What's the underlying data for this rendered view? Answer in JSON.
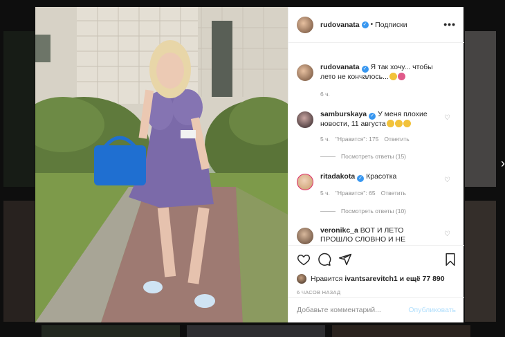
{
  "post": {
    "author": "rudovanata",
    "follow_label": "Подписки",
    "caption_user": "rudovanata",
    "caption_text": "Я так хочу... чтобы лето не кончалось...",
    "caption_time": "6 ч."
  },
  "comments": [
    {
      "user": "samburskaya",
      "text": "У меня плохие новости, 11 августа",
      "time": "5 ч.",
      "likes": "\"Нравится\": 175",
      "reply_label": "Ответить",
      "replies": "Посмотреть ответы (15)"
    },
    {
      "user": "ritadakota",
      "text": "Красотка",
      "time": "5 ч.",
      "likes": "\"Нравится\": 65",
      "reply_label": "Ответить",
      "replies": "Посмотреть ответы (10)"
    },
    {
      "user": "veronikc_a",
      "text": "ВОТ И ЛЕТО ПРОШЛО СЛОВНО И НЕ"
    }
  ],
  "likes": {
    "prefix": "Нравится",
    "user": "ivantsarevitch1",
    "suffix": "и ещё 77 890"
  },
  "timestamp": "6 ЧАСОВ НАЗАД",
  "comment_input": {
    "placeholder": "Добавьте комментарий...",
    "publish_label": "Опубликовать"
  },
  "colors": {
    "verified": "#3897f0",
    "publish_disabled": "#b2dffc",
    "muted": "#8e8e8e"
  },
  "icons": [
    "heart-icon",
    "comment-icon",
    "share-icon",
    "bookmark-icon",
    "more-options-icon",
    "verified-badge-icon",
    "chevron-right-icon"
  ]
}
